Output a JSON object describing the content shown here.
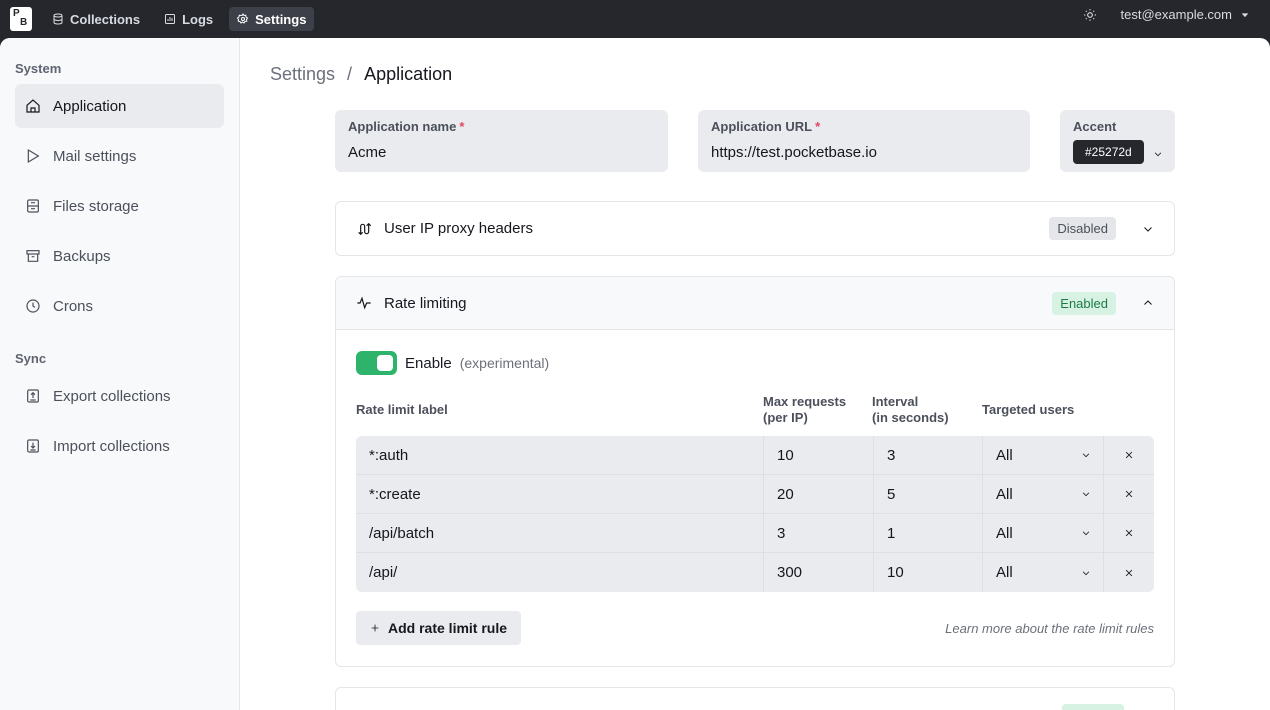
{
  "topbar": {
    "logo_top": "P",
    "logo_bottom": "B",
    "nav": [
      {
        "label": "Collections",
        "icon": "database-icon",
        "active": false
      },
      {
        "label": "Logs",
        "icon": "chart-icon",
        "active": false
      },
      {
        "label": "Settings",
        "icon": "gear-icon",
        "active": true
      }
    ],
    "user_email": "test@example.com"
  },
  "sidebar": {
    "groups": [
      {
        "title": "System",
        "items": [
          {
            "label": "Application",
            "icon": "home-icon",
            "active": true
          },
          {
            "label": "Mail settings",
            "icon": "send-icon",
            "active": false
          },
          {
            "label": "Files storage",
            "icon": "file-icon",
            "active": false
          },
          {
            "label": "Backups",
            "icon": "archive-icon",
            "active": false
          },
          {
            "label": "Crons",
            "icon": "clock-icon",
            "active": false
          }
        ]
      },
      {
        "title": "Sync",
        "items": [
          {
            "label": "Export collections",
            "icon": "export-icon",
            "active": false
          },
          {
            "label": "Import collections",
            "icon": "import-icon",
            "active": false
          }
        ]
      }
    ]
  },
  "breadcrumb": {
    "parent": "Settings",
    "separator": "/",
    "current": "Application"
  },
  "form": {
    "app_name": {
      "label": "Application name",
      "required": "*",
      "value": "Acme"
    },
    "app_url": {
      "label": "Application URL",
      "required": "*",
      "value": "https://test.pocketbase.io"
    },
    "accent": {
      "label": "Accent",
      "value": "#25272d"
    }
  },
  "panels": {
    "proxy": {
      "title": "User IP proxy headers",
      "badge": "Disabled"
    },
    "rate": {
      "title": "Rate limiting",
      "badge": "Enabled",
      "enable_label": "Enable",
      "enable_note": "(experimental)",
      "headers": {
        "label": "Rate limit label",
        "max_l1": "Max requests",
        "max_l2": "(per IP)",
        "interval_l1": "Interval",
        "interval_l2": "(in seconds)",
        "users": "Targeted users"
      },
      "rules": [
        {
          "label": "*:auth",
          "max": "10",
          "interval": "3",
          "users": "All"
        },
        {
          "label": "*:create",
          "max": "20",
          "interval": "5",
          "users": "All"
        },
        {
          "label": "/api/batch",
          "max": "3",
          "interval": "1",
          "users": "All"
        },
        {
          "label": "/api/",
          "max": "300",
          "interval": "10",
          "users": "All"
        }
      ],
      "add_label": "Add rate limit rule",
      "learn_more": "Learn more about the rate limit rules"
    }
  },
  "colors": {
    "accent": "#25272d",
    "enabled": "#2eb36b",
    "required": "#e34562"
  }
}
